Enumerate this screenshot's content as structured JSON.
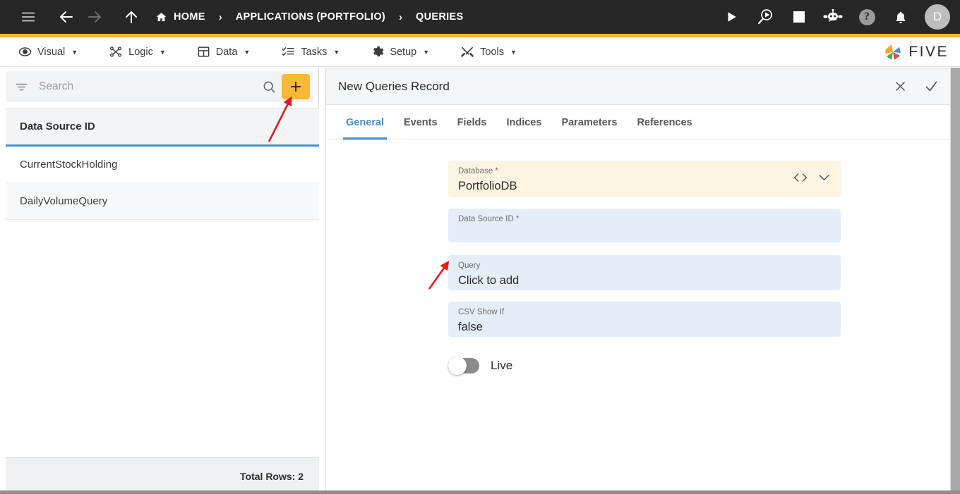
{
  "topbar": {
    "menu_icon": "hamburger-icon",
    "back_icon": "arrow-left-icon",
    "forward_icon": "arrow-right-icon",
    "up_icon": "arrow-up-icon",
    "breadcrumbs": [
      {
        "label": "HOME",
        "icon": "home-icon"
      },
      {
        "label": "APPLICATIONS (PORTFOLIO)",
        "icon": ""
      },
      {
        "label": "QUERIES",
        "icon": ""
      }
    ],
    "separator": "›",
    "actions": [
      {
        "name": "run-icon",
        "title": "Run"
      },
      {
        "name": "debug-icon",
        "title": "Debug"
      },
      {
        "name": "stop-icon",
        "title": "Stop"
      },
      {
        "name": "chatbot-icon",
        "title": "Assistant"
      },
      {
        "name": "help-icon",
        "title": "Help",
        "glyph": "?"
      },
      {
        "name": "notifications-icon",
        "title": "Notifications"
      }
    ],
    "avatar_initial": "D",
    "accent_color": "#f9b931",
    "background_color": "#272727"
  },
  "menubar": {
    "items": [
      {
        "label": "Visual",
        "icon": "eye-icon",
        "caret": "▼"
      },
      {
        "label": "Logic",
        "icon": "nodes-icon",
        "caret": "▼"
      },
      {
        "label": "Data",
        "icon": "table-icon",
        "caret": "▼"
      },
      {
        "label": "Tasks",
        "icon": "checklist-icon",
        "caret": "▼"
      },
      {
        "label": "Setup",
        "icon": "gear-icon",
        "caret": "▼"
      },
      {
        "label": "Tools",
        "icon": "wrench-icon",
        "caret": "▼"
      }
    ],
    "brand": {
      "text": "FIVE",
      "logo": "five-pinwheel-logo"
    }
  },
  "left_panel": {
    "search": {
      "placeholder": "Search",
      "value": "",
      "filter_icon": "filter-icon",
      "search_icon": "search-icon"
    },
    "add_button": {
      "label": "+",
      "name": "add-record-button",
      "color": "#f9b931"
    },
    "grid": {
      "columns": [
        "Data Source ID"
      ],
      "rows": [
        {
          "data_source_id": "CurrentStockHolding"
        },
        {
          "data_source_id": "DailyVolumeQuery"
        }
      ],
      "header_underline_color": "#4a8fd4"
    },
    "footer": {
      "total_rows_label": "Total Rows: 2"
    }
  },
  "record_panel": {
    "title": "New Queries Record",
    "close_label": "✕",
    "confirm_label": "✓",
    "tabs": [
      {
        "label": "General",
        "active": true
      },
      {
        "label": "Events",
        "active": false
      },
      {
        "label": "Fields",
        "active": false
      },
      {
        "label": "Indices",
        "active": false
      },
      {
        "label": "Parameters",
        "active": false
      },
      {
        "label": "References",
        "active": false
      }
    ],
    "active_tab_color": "#4a8fd4",
    "fields": [
      {
        "label": "Database *",
        "value": "PortfolioDB",
        "style": "cream",
        "icons": [
          "code-brackets-icon",
          "chevron-down-icon"
        ]
      },
      {
        "label": "Data Source ID *",
        "value": "",
        "style": "blue",
        "icons": []
      },
      {
        "label": "Query",
        "value": "Click to add",
        "style": "blue",
        "icons": []
      },
      {
        "label": "CSV Show If",
        "value": "false",
        "style": "blue",
        "icons": []
      }
    ],
    "toggle": {
      "label": "Live",
      "checked": false
    }
  },
  "annotations": {
    "arrow_color": "#e8191a",
    "arrows": [
      {
        "name": "arrow-to-add-button",
        "target": "add-record-button"
      },
      {
        "name": "arrow-to-query-field",
        "target": "query-field"
      }
    ]
  }
}
